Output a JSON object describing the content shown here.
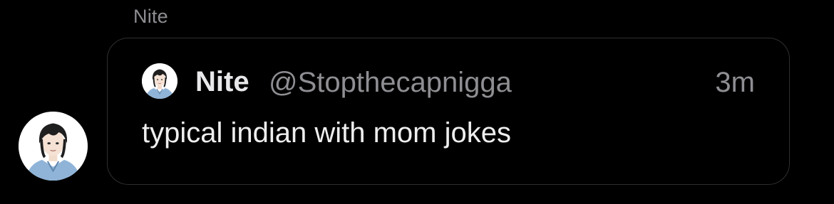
{
  "message": {
    "sender_name": "Nite",
    "sender_avatar_icon": "anime-portrait-avatar"
  },
  "quote": {
    "author_name": "Nite",
    "author_handle": "@Stopthecapnigga",
    "time": "3m",
    "text": "typical indian with mom jokes",
    "author_avatar_icon": "anime-portrait-avatar"
  },
  "colors": {
    "background": "#000000",
    "secondary_text": "#8e8e93",
    "primary_text": "#eeeeee",
    "bubble_border": "#2f2f33"
  }
}
